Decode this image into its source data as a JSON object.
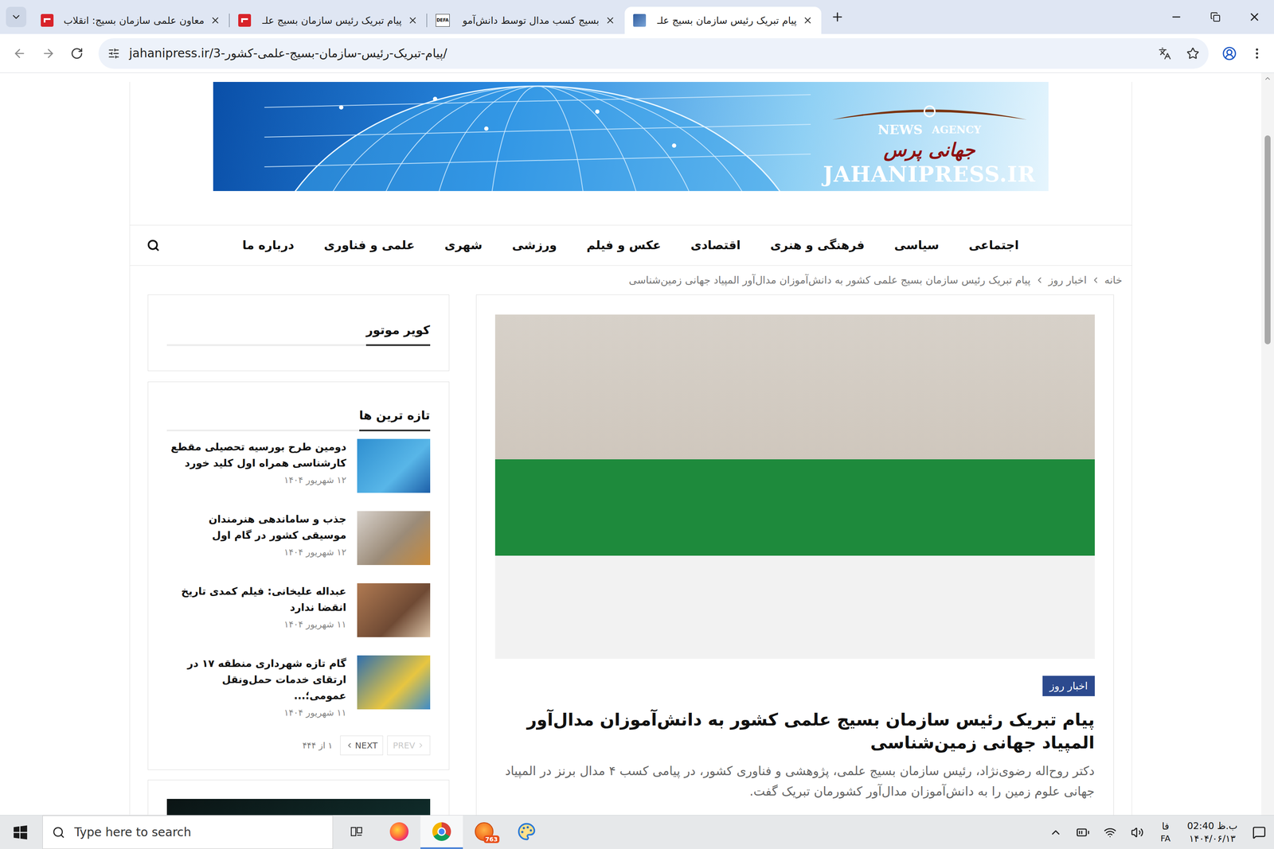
{
  "browser": {
    "tabs": [
      {
        "title": "معاون علمی سازمان بسیج: انقلاب",
        "kind": "red-logo",
        "selected": false
      },
      {
        "title": "پیام تبریک رئیس سازمان بسیج علـ",
        "kind": "red-logo",
        "selected": false
      },
      {
        "title": "بسیج کسب مدال توسط دانش‌آمو",
        "kind": "text-logo",
        "favicon_text": "DEFA",
        "selected": false
      },
      {
        "title": "پیام تبریک رئیس سازمان بسیج علـ",
        "kind": "photo",
        "selected": true
      }
    ],
    "url": "jahanipress.ir/پیام-تبریک-رئیس-سازمان-بسیج-علمی-کشور-3/"
  },
  "banner": {
    "news": "NEWS",
    "agency": "AGENCY",
    "name_fa": "جهانی پرس",
    "domain": "JAHANIPRESS.IR"
  },
  "nav": [
    "اجتماعی",
    "سیاسی",
    "فرهنگی و هنری",
    "اقتصادی",
    "عکس و فیلم",
    "ورزشی",
    "شهری",
    "علمی و فناوری",
    "درباره ما"
  ],
  "breadcrumb": [
    "خانه",
    "اخبار روز",
    "پیام تبریک رئیس سازمان بسیج علمی کشور به دانش‌آموزان مدال‌آور المپیاد جهانی زمین‌شناسی"
  ],
  "article": {
    "category": "اخبار روز",
    "title": "پیام تبریک رئیس سازمان بسیج علمی کشور به دانش‌آموزان مدال‌آور المپیاد جهانی زمین‌شناسی",
    "summary": "دکتر روح‌اله رضوی‌نژاد، رئیس سازمان بسیج علمی، پژوهشی و فناوری کشور، در پیامی کسب ۴ مدال برنز در المپیاد جهانی علوم زمین را به دانش‌آموزان مدال‌آور کشورمان تبریک گفت."
  },
  "sidebar": {
    "ad_widget": {
      "title": "کویر موتور"
    },
    "latest": {
      "title": "تازه ترین ها",
      "items": [
        {
          "title": "دومین طرح بورسیه تحصیلی مقطع کارشناسی همراه اول کلید خورد",
          "date": "۱۲ شهریور ۱۴۰۴"
        },
        {
          "title": "جذب و ساماندهی هنرمندان موسیقی کشور در گام اول",
          "date": "۱۲ شهریور ۱۴۰۴"
        },
        {
          "title": "عبداله علیخانی: فیلم کمدی تاریخ انقضا ندارد",
          "date": "۱۱ شهریور ۱۴۰۴"
        },
        {
          "title": "گام تازه شهرداری منطقه ۱۷ در ارتقای خدمات حمل‌ونقل عمومی؛...",
          "date": "۱۱ شهریور ۱۴۰۴"
        }
      ],
      "pagination": {
        "prev": "PREV",
        "prev_disabled": true,
        "next": "NEXT",
        "next_disabled": false,
        "page": "۱ از ۴۴۴"
      }
    }
  },
  "taskbar": {
    "search_placeholder": "Type here to search",
    "apps": [
      {
        "kind": "task-view",
        "selected": false
      },
      {
        "kind": "firefox",
        "selected": false
      },
      {
        "kind": "chrome",
        "selected": true
      },
      {
        "kind": "badge-app",
        "selected": false,
        "badge": "763"
      },
      {
        "kind": "paint",
        "selected": false
      }
    ],
    "language": {
      "fa": "فا",
      "en": "FA"
    },
    "time": "02:40 ب.ظ",
    "date": "۱۴۰۴/۰۶/۱۳"
  }
}
